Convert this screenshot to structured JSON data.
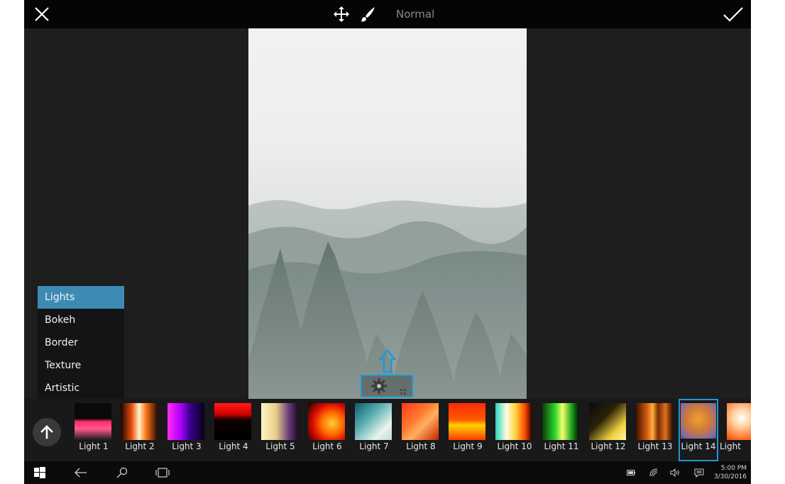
{
  "toolbar": {
    "mode": "Normal",
    "icons": [
      "close-icon",
      "move-icon",
      "brush-icon",
      "checkmark-icon"
    ]
  },
  "categories": [
    {
      "label": "Lights",
      "active": true
    },
    {
      "label": "Bokeh",
      "active": false
    },
    {
      "label": "Border",
      "active": false
    },
    {
      "label": "Texture",
      "active": false
    },
    {
      "label": "Artistic",
      "active": false
    }
  ],
  "effects": [
    {
      "label": "Light 1"
    },
    {
      "label": "Light 2"
    },
    {
      "label": "Light 3"
    },
    {
      "label": "Light 4"
    },
    {
      "label": "Light 5"
    },
    {
      "label": "Light 6"
    },
    {
      "label": "Light 7"
    },
    {
      "label": "Light 8"
    },
    {
      "label": "Light 9"
    },
    {
      "label": "Light 10"
    },
    {
      "label": "Light 11"
    },
    {
      "label": "Light 12"
    },
    {
      "label": "Light 13"
    },
    {
      "label": "Light 14",
      "selected": true
    },
    {
      "label": "Light"
    }
  ],
  "taskbar": {
    "time": "5:00 PM",
    "date": "3/30/2016",
    "icons": [
      "windows-start-icon",
      "back-icon",
      "search-icon",
      "task-view-icon",
      "battery-icon",
      "wifi-icon",
      "volume-icon",
      "notifications-icon"
    ]
  },
  "colors": {
    "accent": "#1e97d6",
    "menu_active": "#3b8bb4",
    "background": "#1e1e1e",
    "topbar": "#050505"
  }
}
